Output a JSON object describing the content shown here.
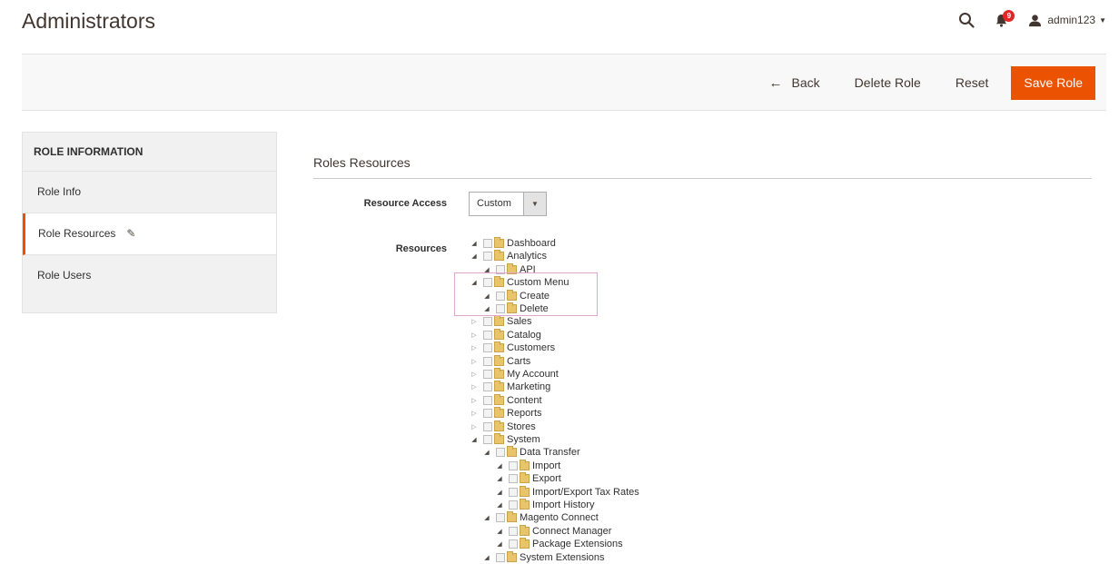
{
  "header": {
    "title": "Administrators",
    "notifications_count": "9",
    "user_name": "admin123"
  },
  "actions": {
    "back": "Back",
    "delete_role": "Delete Role",
    "reset": "Reset",
    "save_role": "Save Role"
  },
  "sidebar": {
    "title": "ROLE INFORMATION",
    "items": [
      {
        "label": "Role Info"
      },
      {
        "label": "Role Resources"
      },
      {
        "label": "Role Users"
      }
    ]
  },
  "main": {
    "section_title": "Roles Resources",
    "resource_access_label": "Resource Access",
    "resource_access_value": "Custom",
    "resources_label": "Resources"
  },
  "tree": [
    {
      "label": "Dashboard",
      "level": 0,
      "expanded": true
    },
    {
      "label": "Analytics",
      "level": 0,
      "expanded": true
    },
    {
      "label": "API",
      "level": 1,
      "expanded": true
    },
    {
      "label": "Custom Menu",
      "level": 0,
      "expanded": true
    },
    {
      "label": "Create",
      "level": 1,
      "expanded": true
    },
    {
      "label": "Delete",
      "level": 1,
      "expanded": true
    },
    {
      "label": "Sales",
      "level": 0,
      "expanded": false
    },
    {
      "label": "Catalog",
      "level": 0,
      "expanded": false
    },
    {
      "label": "Customers",
      "level": 0,
      "expanded": false
    },
    {
      "label": "Carts",
      "level": 0,
      "expanded": false
    },
    {
      "label": "My Account",
      "level": 0,
      "expanded": false
    },
    {
      "label": "Marketing",
      "level": 0,
      "expanded": false
    },
    {
      "label": "Content",
      "level": 0,
      "expanded": false
    },
    {
      "label": "Reports",
      "level": 0,
      "expanded": false
    },
    {
      "label": "Stores",
      "level": 0,
      "expanded": false
    },
    {
      "label": "System",
      "level": 0,
      "expanded": true
    },
    {
      "label": "Data Transfer",
      "level": 1,
      "expanded": true
    },
    {
      "label": "Import",
      "level": 2,
      "expanded": true
    },
    {
      "label": "Export",
      "level": 2,
      "expanded": true
    },
    {
      "label": "Import/Export Tax Rates",
      "level": 2,
      "expanded": true
    },
    {
      "label": "Import History",
      "level": 2,
      "expanded": true
    },
    {
      "label": "Magento Connect",
      "level": 1,
      "expanded": true
    },
    {
      "label": "Connect Manager",
      "level": 2,
      "expanded": true
    },
    {
      "label": "Package Extensions",
      "level": 2,
      "expanded": true
    },
    {
      "label": "System Extensions",
      "level": 1,
      "expanded": true
    }
  ],
  "colors": {
    "accent": "#eb5202",
    "highlight_border": "#e3a6d1"
  }
}
